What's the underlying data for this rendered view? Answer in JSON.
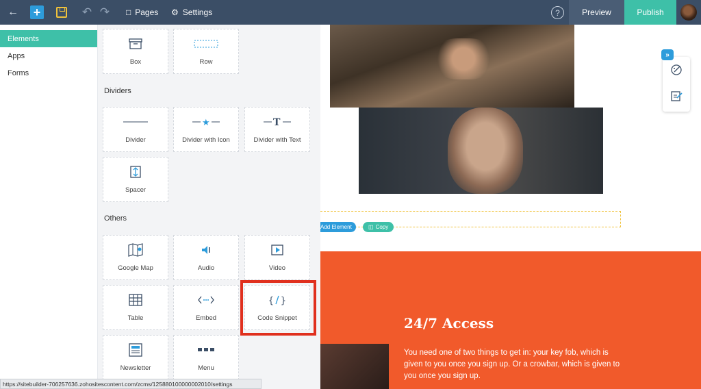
{
  "topbar": {
    "pages_label": "Pages",
    "settings_label": "Settings",
    "help_label": "?",
    "preview_label": "Preview",
    "publish_label": "Publish"
  },
  "leftnav": {
    "items": [
      {
        "label": "Elements",
        "active": true
      },
      {
        "label": "Apps",
        "active": false
      },
      {
        "label": "Forms",
        "active": false
      }
    ]
  },
  "panel": {
    "top_tiles": [
      {
        "label": "Box",
        "icon": "box-icon"
      },
      {
        "label": "Row",
        "icon": "row-icon"
      }
    ],
    "dividers_heading": "Dividers",
    "divider_tiles": [
      {
        "label": "Divider",
        "icon": "divider-icon"
      },
      {
        "label": "Divider with Icon",
        "icon": "divider-star-icon"
      },
      {
        "label": "Divider with Text",
        "icon": "divider-text-icon"
      },
      {
        "label": "Spacer",
        "icon": "spacer-icon"
      }
    ],
    "others_heading": "Others",
    "other_tiles": [
      {
        "label": "Google Map",
        "icon": "map-icon"
      },
      {
        "label": "Audio",
        "icon": "audio-icon"
      },
      {
        "label": "Video",
        "icon": "video-icon"
      },
      {
        "label": "Table",
        "icon": "table-icon"
      },
      {
        "label": "Embed",
        "icon": "embed-icon"
      },
      {
        "label": "Code Snippet",
        "icon": "code-icon"
      },
      {
        "label": "Newsletter",
        "icon": "newsletter-icon"
      },
      {
        "label": "Menu",
        "icon": "menu-icon"
      }
    ]
  },
  "canvas": {
    "add_element_label": "Add Element",
    "copy_label": "Copy",
    "section_title": "24/7 Access",
    "section_body": "You need one of two things to get in: your key fob, which is given to you once you sign up. Or a crowbar, which is given to you once you sign up."
  },
  "statusbar": {
    "url": "https://sitebuilder-706257636.zohositescontent.com/zcms/125880100000002010/settings"
  },
  "colors": {
    "topbar": "#3b4e66",
    "accent_green": "#3ec0a8",
    "accent_blue": "#2d9cdb",
    "orange_section": "#f15a2b",
    "highlight": "#e0301e"
  }
}
